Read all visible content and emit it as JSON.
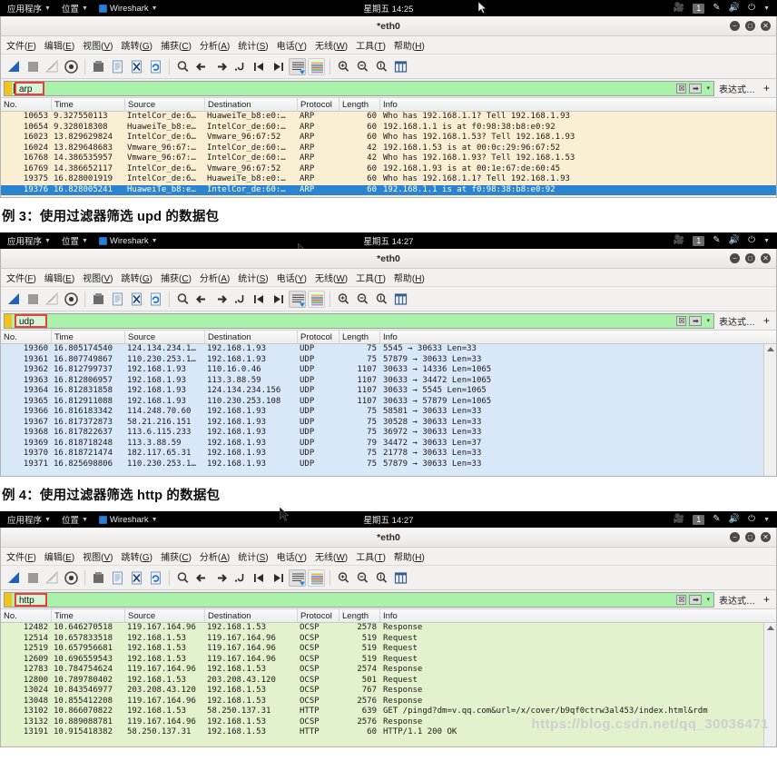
{
  "desktop": {
    "app_menu": "应用程序",
    "places_menu": "位置",
    "wireshark_menu": "Wireshark",
    "clock_1425": "星期五 14:25",
    "clock_1427": "星期五 14:27",
    "workspace_badge": "1",
    "tray_icons": [
      "screencast-icon",
      "workspace-badge",
      "pencil-icon",
      "volume-icon",
      "power-icon",
      "chevron-down-icon"
    ]
  },
  "window": {
    "title": "*eth0",
    "minimize": "−",
    "maximize": "□",
    "close": "✕"
  },
  "menubar": [
    {
      "label": "文件",
      "accel": "F"
    },
    {
      "label": "编辑",
      "accel": "E"
    },
    {
      "label": "视图",
      "accel": "V"
    },
    {
      "label": "跳转",
      "accel": "G"
    },
    {
      "label": "捕获",
      "accel": "C"
    },
    {
      "label": "分析",
      "accel": "A"
    },
    {
      "label": "统计",
      "accel": "S"
    },
    {
      "label": "电话",
      "accel": "Y"
    },
    {
      "label": "无线",
      "accel": "W"
    },
    {
      "label": "工具",
      "accel": "T"
    },
    {
      "label": "帮助",
      "accel": "H"
    }
  ],
  "toolbar_icons": [
    "start-capture-icon",
    "stop-capture-icon",
    "restart-capture-icon",
    "capture-options-icon",
    "open-file-icon",
    "save-file-icon",
    "close-file-icon",
    "reload-file-icon",
    "find-packet-icon",
    "go-back-icon",
    "go-forward-icon",
    "go-to-packet-icon",
    "go-first-packet-icon",
    "go-last-packet-icon",
    "autoscroll-icon",
    "colorize-icon",
    "zoom-in-icon",
    "zoom-out-icon",
    "zoom-reset-icon",
    "resize-columns-icon"
  ],
  "filter": {
    "clear_label": "☒",
    "apply_label": "➡",
    "dropdown_label": "▾",
    "expression_label": "表达式…",
    "plus_label": "+",
    "values": {
      "arp": "arp",
      "udp": "udp",
      "http": "http"
    }
  },
  "columns": [
    "No.",
    "Time",
    "Source",
    "Destination",
    "Protocol",
    "Length",
    "Info"
  ],
  "sections": [
    {
      "id": "arp",
      "caption": null,
      "clock": "星期五 14:25",
      "filter_value": "arp",
      "row_class": "row-arp",
      "rows": [
        {
          "no": "10653",
          "time": "9.327550113",
          "src": "IntelCor_de:6…",
          "dst": "HuaweiTe_b8:e0:…",
          "proto": "ARP",
          "len": "60",
          "info": "Who has 192.168.1.1? Tell 192.168.1.93",
          "selected": false
        },
        {
          "no": "10654",
          "time": "9.328018308",
          "src": "HuaweiTe_b8:e…",
          "dst": "IntelCor_de:60:…",
          "proto": "ARP",
          "len": "60",
          "info": "192.168.1.1 is at f0:98:38:b8:e0:92",
          "selected": false
        },
        {
          "no": "16023",
          "time": "13.829629824",
          "src": "IntelCor_de:6…",
          "dst": "Vmware_96:67:52",
          "proto": "ARP",
          "len": "60",
          "info": "Who has 192.168.1.53? Tell 192.168.1.93",
          "selected": false
        },
        {
          "no": "16024",
          "time": "13.829648683",
          "src": "Vmware_96:67:…",
          "dst": "IntelCor_de:60:…",
          "proto": "ARP",
          "len": "42",
          "info": "192.168.1.53 is at 00:0c:29:96:67:52",
          "selected": false
        },
        {
          "no": "16768",
          "time": "14.386535957",
          "src": "Vmware_96:67:…",
          "dst": "IntelCor_de:60:…",
          "proto": "ARP",
          "len": "42",
          "info": "Who has 192.168.1.93? Tell 192.168.1.53",
          "selected": false
        },
        {
          "no": "16769",
          "time": "14.386652117",
          "src": "IntelCor_de:6…",
          "dst": "Vmware_96:67:52",
          "proto": "ARP",
          "len": "60",
          "info": "192.168.1.93 is at 00:1e:67:de:60:45",
          "selected": false
        },
        {
          "no": "19375",
          "time": "16.828001919",
          "src": "IntelCor_de:6…",
          "dst": "HuaweiTe_b8:e0:…",
          "proto": "ARP",
          "len": "60",
          "info": "Who has 192.168.1.1? Tell 192.168.1.93",
          "selected": false
        },
        {
          "no": "19376",
          "time": "16.828005241",
          "src": "HuaweiTe_b8:e…",
          "dst": "IntelCor_de:60:…",
          "proto": "ARP",
          "len": "60",
          "info": "192.168.1.1 is at f0:98:38:b8:e0:92",
          "selected": true
        }
      ]
    },
    {
      "id": "udp",
      "caption": "例 3：使用过滤器筛选 upd 的数据包",
      "clock": "星期五 14:27",
      "filter_value": "udp",
      "row_class": "row-udp",
      "rows": [
        {
          "no": "19360",
          "time": "16.805174540",
          "src": "124.134.234.1…",
          "dst": "192.168.1.93",
          "proto": "UDP",
          "len": "75",
          "info": "5545 → 30633 Len=33",
          "selected": false
        },
        {
          "no": "19361",
          "time": "16.807749867",
          "src": "110.230.253.1…",
          "dst": "192.168.1.93",
          "proto": "UDP",
          "len": "75",
          "info": "57879 → 30633 Len=33",
          "selected": false
        },
        {
          "no": "19362",
          "time": "16.812799737",
          "src": "192.168.1.93",
          "dst": "110.16.0.46",
          "proto": "UDP",
          "len": "1107",
          "info": "30633 → 14336 Len=1065",
          "selected": false
        },
        {
          "no": "19363",
          "time": "16.812806957",
          "src": "192.168.1.93",
          "dst": "113.3.88.59",
          "proto": "UDP",
          "len": "1107",
          "info": "30633 → 34472 Len=1065",
          "selected": false
        },
        {
          "no": "19364",
          "time": "16.812831858",
          "src": "192.168.1.93",
          "dst": "124.134.234.156",
          "proto": "UDP",
          "len": "1107",
          "info": "30633 → 5545 Len=1065",
          "selected": false
        },
        {
          "no": "19365",
          "time": "16.812911088",
          "src": "192.168.1.93",
          "dst": "110.230.253.108",
          "proto": "UDP",
          "len": "1107",
          "info": "30633 → 57879 Len=1065",
          "selected": false
        },
        {
          "no": "19366",
          "time": "16.816183342",
          "src": "114.248.70.60",
          "dst": "192.168.1.93",
          "proto": "UDP",
          "len": "75",
          "info": "58581 → 30633 Len=33",
          "selected": false
        },
        {
          "no": "19367",
          "time": "16.817372873",
          "src": "58.21.216.151",
          "dst": "192.168.1.93",
          "proto": "UDP",
          "len": "75",
          "info": "30528 → 30633 Len=33",
          "selected": false
        },
        {
          "no": "19368",
          "time": "16.817822637",
          "src": "113.6.115.233",
          "dst": "192.168.1.93",
          "proto": "UDP",
          "len": "75",
          "info": "36972 → 30633 Len=33",
          "selected": false
        },
        {
          "no": "19369",
          "time": "16.818718248",
          "src": "113.3.88.59",
          "dst": "192.168.1.93",
          "proto": "UDP",
          "len": "79",
          "info": "34472 → 30633 Len=37",
          "selected": false
        },
        {
          "no": "19370",
          "time": "16.818721474",
          "src": "182.117.65.31",
          "dst": "192.168.1.93",
          "proto": "UDP",
          "len": "75",
          "info": "21778 → 30633 Len=33",
          "selected": false
        },
        {
          "no": "19371",
          "time": "16.825698806",
          "src": "110.230.253.1…",
          "dst": "192.168.1.93",
          "proto": "UDP",
          "len": "75",
          "info": "57879 → 30633 Len=33",
          "selected": false
        }
      ]
    },
    {
      "id": "http",
      "caption": "例 4：使用过滤器筛选 http 的数据包",
      "clock": "星期五 14:27",
      "filter_value": "http",
      "row_class": "row-http",
      "rows": [
        {
          "no": "12482",
          "time": "10.646270518",
          "src": "119.167.164.96",
          "dst": "192.168.1.53",
          "proto": "OCSP",
          "len": "2578",
          "info": "Response",
          "selected": false
        },
        {
          "no": "12514",
          "time": "10.657833518",
          "src": "192.168.1.53",
          "dst": "119.167.164.96",
          "proto": "OCSP",
          "len": "519",
          "info": "Request",
          "selected": false
        },
        {
          "no": "12519",
          "time": "10.657956681",
          "src": "192.168.1.53",
          "dst": "119.167.164.96",
          "proto": "OCSP",
          "len": "519",
          "info": "Request",
          "selected": false
        },
        {
          "no": "12609",
          "time": "10.696559543",
          "src": "192.168.1.53",
          "dst": "119.167.164.96",
          "proto": "OCSP",
          "len": "519",
          "info": "Request",
          "selected": false
        },
        {
          "no": "12783",
          "time": "10.784754624",
          "src": "119.167.164.96",
          "dst": "192.168.1.53",
          "proto": "OCSP",
          "len": "2574",
          "info": "Response",
          "selected": false
        },
        {
          "no": "12800",
          "time": "10.789780402",
          "src": "192.168.1.53",
          "dst": "203.208.43.120",
          "proto": "OCSP",
          "len": "501",
          "info": "Request",
          "selected": false
        },
        {
          "no": "13024",
          "time": "10.843546977",
          "src": "203.208.43.120",
          "dst": "192.168.1.53",
          "proto": "OCSP",
          "len": "767",
          "info": "Response",
          "selected": false
        },
        {
          "no": "13048",
          "time": "10.855412208",
          "src": "119.167.164.96",
          "dst": "192.168.1.53",
          "proto": "OCSP",
          "len": "2576",
          "info": "Response",
          "selected": false
        },
        {
          "no": "13102",
          "time": "10.866070822",
          "src": "192.168.1.53",
          "dst": "58.250.137.31",
          "proto": "HTTP",
          "len": "639",
          "info": "GET /pingd?dm=v.qq.com&url=/x/cover/b9qf0ctrw3al453/index.html&rdm",
          "selected": false
        },
        {
          "no": "13132",
          "time": "10.889088781",
          "src": "119.167.164.96",
          "dst": "192.168.1.53",
          "proto": "OCSP",
          "len": "2576",
          "info": "Response",
          "selected": false
        },
        {
          "no": "13191",
          "time": "10.915418382",
          "src": "58.250.137.31",
          "dst": "192.168.1.53",
          "proto": "HTTP",
          "len": "60",
          "info": "HTTP/1.1 200 OK",
          "selected": false
        }
      ]
    }
  ],
  "watermark": "https://blog.csdn.net/qq_30036471"
}
